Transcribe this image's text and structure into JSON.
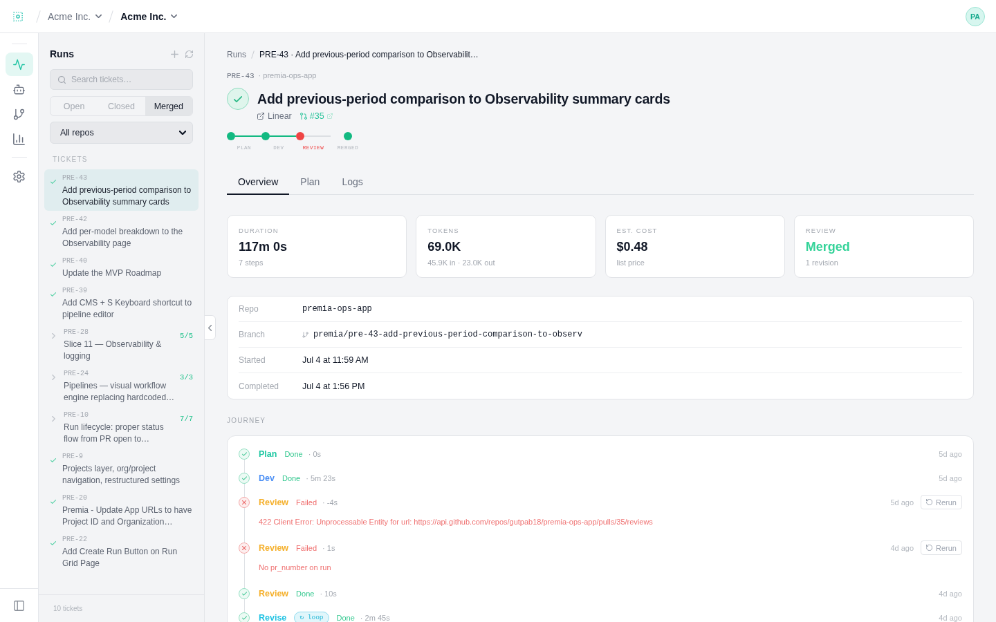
{
  "header": {
    "org_switchers": [
      {
        "label": "Acme Inc.",
        "current": false
      },
      {
        "label": "Acme Inc.",
        "current": true
      }
    ],
    "avatar": "PA"
  },
  "nav_rail": {
    "primary": [
      {
        "selected": true
      },
      {
        "selected": false
      },
      {
        "selected": false
      },
      {
        "selected": false
      }
    ],
    "secondary": [
      {
        "selected": false
      }
    ]
  },
  "runs_panel": {
    "title": "Runs",
    "search": {
      "placeholder": "Search tickets…"
    },
    "filters": [
      {
        "label": "Open",
        "selected": false
      },
      {
        "label": "Closed",
        "selected": false
      },
      {
        "label": "Merged",
        "selected": true
      }
    ],
    "repo_select": {
      "value": "All repos"
    },
    "section_label": "TICKETS",
    "tickets": [
      {
        "kind": "ticket",
        "id": "PRE-43",
        "title": "Add previous-period comparison to Observability summary cards",
        "selected": true
      },
      {
        "kind": "ticket",
        "id": "PRE-42",
        "title": "Add per-model breakdown to the Observability page",
        "selected": false
      },
      {
        "kind": "ticket",
        "id": "PRE-40",
        "title": "Update the MVP Roadmap",
        "selected": false
      },
      {
        "kind": "ticket",
        "id": "PRE-39",
        "title": "Add CMS + S Keyboard shortcut to pipeline editor",
        "selected": false
      },
      {
        "kind": "epic",
        "id": "PRE-28",
        "title": "Slice 11 — Observability & logging",
        "progress": "5/5",
        "selected": false
      },
      {
        "kind": "epic",
        "id": "PRE-24",
        "title": "Pipelines — visual workflow engine replacing hardcoded…",
        "progress": "3/3",
        "selected": false
      },
      {
        "kind": "epic",
        "id": "PRE-10",
        "title": "Run lifecycle: proper status flow from PR open to…",
        "progress": "7/7",
        "selected": false
      },
      {
        "kind": "ticket",
        "id": "PRE-9",
        "title": "Projects layer, org/project navigation, restructured settings",
        "selected": false
      },
      {
        "kind": "ticket",
        "id": "PRE-20",
        "title": "Premia - Update App URLs to have Project ID and Organization…",
        "selected": false
      },
      {
        "kind": "ticket",
        "id": "PRE-22",
        "title": "Add Create Run Button on Run Grid Page",
        "selected": false
      }
    ],
    "footer": "10 tickets"
  },
  "run": {
    "breadcrumb": [
      "Runs",
      "PRE-43 · Add previous-period comparison to Observabilit…"
    ],
    "id": "PRE-43",
    "repo": "· premia-ops-app",
    "succeeded": true,
    "title": "Add previous-period comparison to Observability summary cards",
    "links": [
      {
        "kind": "tracker",
        "label": "Linear"
      },
      {
        "kind": "pull_request",
        "label": "#35"
      }
    ],
    "stages": [
      {
        "label": "PLAN",
        "done": true,
        "failed": false
      },
      {
        "label": "DEV",
        "done": true,
        "failed": false
      },
      {
        "label": "REVIEW",
        "done": false,
        "failed": true
      },
      {
        "label": "MERGED",
        "done": true,
        "failed": false
      }
    ],
    "tabs": [
      {
        "label": "Overview",
        "selected": true
      },
      {
        "label": "Plan",
        "selected": false
      },
      {
        "label": "Logs",
        "selected": false
      }
    ],
    "stats": [
      {
        "label": "DURATION",
        "value": "117m 0s",
        "note": "7 steps",
        "highlight": false
      },
      {
        "label": "TOKENS",
        "value": "69.0K",
        "note": "45.9K in · 23.0K out",
        "highlight": false
      },
      {
        "label": "EST. COST",
        "value": "$0.48",
        "note": "list price",
        "highlight": false
      },
      {
        "label": "REVIEW",
        "value": "Merged",
        "note": "1 revision",
        "highlight": true
      }
    ],
    "details": [
      {
        "kind": "code",
        "label": "Repo",
        "value": "premia-ops-app"
      },
      {
        "kind": "branch",
        "label": "Branch",
        "value": "premia/pre-43-add-previous-period-comparison-to-observ"
      },
      {
        "kind": "text",
        "label": "Started",
        "value": "Jul 4 at 11:59 AM"
      },
      {
        "kind": "text",
        "label": "Completed",
        "value": "Jul 4 at 1:56 PM"
      }
    ],
    "journey": {
      "title": "JOURNEY",
      "entries": [
        {
          "step": "Plan",
          "color": "#1fc7a2",
          "done": true,
          "status": "Done",
          "duration": "· 0s",
          "time": "5d ago"
        },
        {
          "step": "Dev",
          "color": "#4b8ff5",
          "done": true,
          "status": "Done",
          "duration": "· 5m 23s",
          "time": "5d ago"
        },
        {
          "step": "Review",
          "color": "#f5b02c",
          "done": false,
          "status": "Failed",
          "duration": "· -4s",
          "time": "5d ago",
          "action": "Rerun",
          "error": "422 Client Error: Unprocessable Entity for url: https://api.github.com/repos/gutpab18/premia-ops-app/pulls/35/reviews"
        },
        {
          "step": "Review",
          "color": "#f5b02c",
          "done": false,
          "status": "Failed",
          "duration": "· 1s",
          "time": "4d ago",
          "action": "Rerun",
          "error": "No pr_number on run"
        },
        {
          "step": "Review",
          "color": "#f5b02c",
          "done": true,
          "status": "Done",
          "duration": "· 10s",
          "time": "4d ago"
        },
        {
          "step": "Revise",
          "color": "#22c3e3",
          "badge": "↻ loop",
          "done": true,
          "status": "Done",
          "duration": "· 2m 45s",
          "time": "4d ago"
        }
      ]
    }
  }
}
